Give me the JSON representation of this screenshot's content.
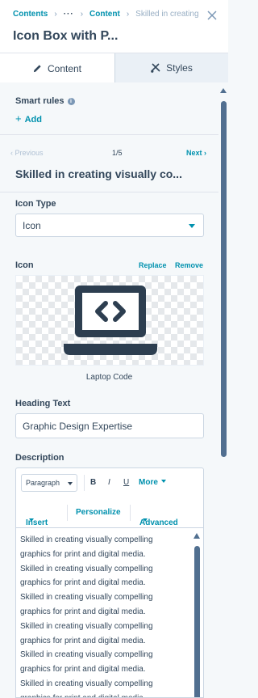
{
  "breadcrumb": {
    "root": "Contents",
    "ellipsis": "···",
    "parent": "Content",
    "current": "Skilled in creating"
  },
  "header": {
    "title": "Icon Box with P..."
  },
  "tabs": [
    {
      "label": "Content",
      "icon": "pencil-icon"
    },
    {
      "label": "Styles",
      "icon": "brush-icon"
    }
  ],
  "smart_rules": {
    "label": "Smart rules",
    "add_label": "Add"
  },
  "pager": {
    "previous": "Previous",
    "position": "1/5",
    "next": "Next"
  },
  "item": {
    "title": "Skilled in creating visually co..."
  },
  "icon_type": {
    "label": "Icon Type",
    "value": "Icon"
  },
  "icon": {
    "label": "Icon",
    "replace": "Replace",
    "remove": "Remove",
    "name": "Laptop Code",
    "icon_name": "laptop-code-icon"
  },
  "heading": {
    "label": "Heading Text",
    "value": "Graphic Design Expertise"
  },
  "description": {
    "label": "Description",
    "paragraph_select": "Paragraph",
    "bold": "B",
    "italic": "I",
    "underline": "U",
    "more": "More",
    "insert": "Insert",
    "personalize": "Personalize",
    "advanced": "Advanced",
    "lines": [
      "Skilled in creating visually compelling",
      "graphics for print and digital media.",
      "Skilled in creating visually compelling",
      "graphics for print and digital media.",
      "Skilled in creating visually compelling",
      "graphics for print and digital media.",
      "Skilled in creating visually compelling",
      "graphics for print and digital media.",
      "Skilled in creating visually compelling",
      "graphics for print and digital media.",
      "Skilled in creating visually compelling",
      "graphics for print and digital media."
    ]
  },
  "colors": {
    "accent": "#0091ae",
    "text": "#33475b",
    "panel": "#f5f8fa"
  }
}
